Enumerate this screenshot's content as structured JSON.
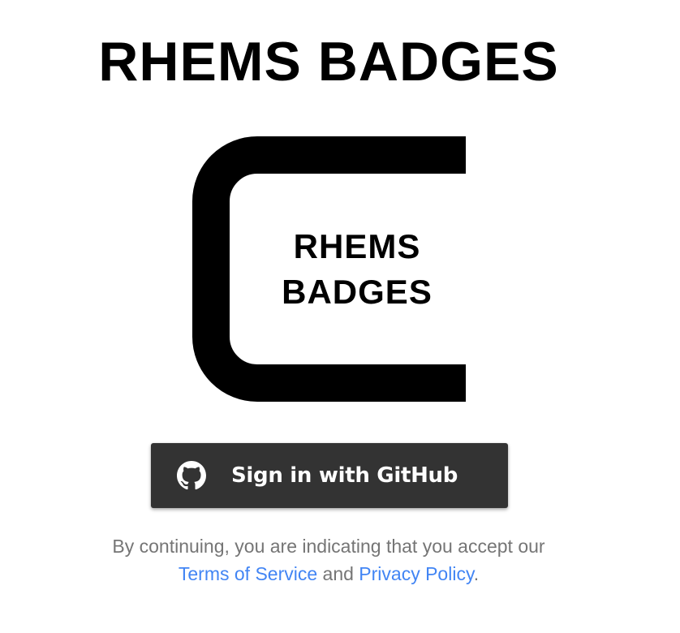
{
  "header": {
    "title": "RHEMS BADGES"
  },
  "logo": {
    "line1": "RHEMS",
    "line2": "BADGES"
  },
  "signin": {
    "icon": "github-icon",
    "label": "Sign in with GitHub",
    "background": "#333333"
  },
  "legal": {
    "intro": "By continuing, you are indicating that you accept our",
    "terms_link": "Terms of Service",
    "conjunction": "and",
    "privacy_link": "Privacy Policy",
    "period": ".",
    "link_color": "#4285f4"
  }
}
